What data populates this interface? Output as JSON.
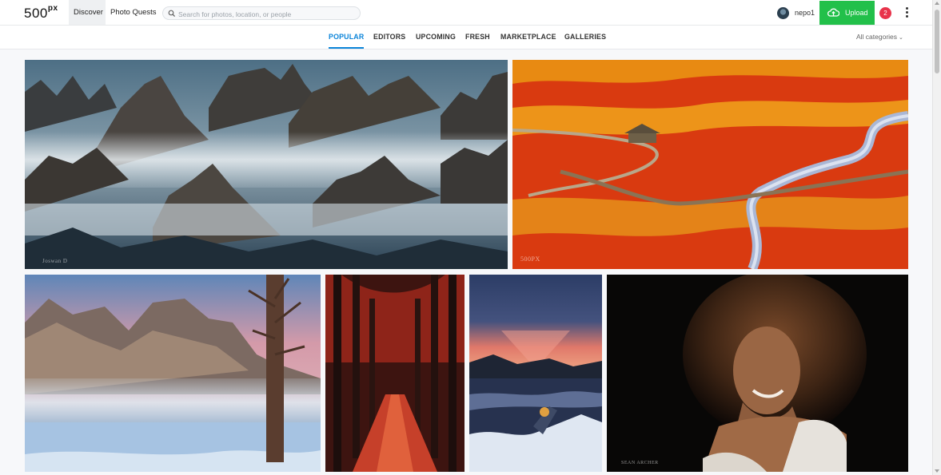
{
  "header": {
    "logo": "500",
    "logo_sup": "px",
    "nav": {
      "discover": "Discover",
      "photo_quests": "Photo Quests"
    },
    "search_placeholder": "Search for photos, location, or people",
    "username": "nepo1",
    "upload_label": "Upload",
    "notification_count": "2"
  },
  "tabs": [
    {
      "label": "POPULAR",
      "active": true
    },
    {
      "label": "EDITORS",
      "active": false
    },
    {
      "label": "UPCOMING",
      "active": false
    },
    {
      "label": "FRESH",
      "active": false
    },
    {
      "label": "MARKETPLACE",
      "active": false
    },
    {
      "label": "GALLERIES",
      "active": false
    }
  ],
  "category_filter": "All categories",
  "photos": [
    {
      "subject": "misty rock pinnacles",
      "watermark": "Joswan D"
    },
    {
      "subject": "red marsh with boardwalk",
      "watermark": "500PX"
    },
    {
      "subject": "snowy mountains and dead tree",
      "watermark": ""
    },
    {
      "subject": "red forest path",
      "watermark": ""
    },
    {
      "subject": "kayaker at sunrise lake",
      "watermark": ""
    },
    {
      "subject": "portrait of smiling woman",
      "watermark": "SEAN ARCHER"
    }
  ],
  "colors": {
    "accent": "#0b84d9",
    "upload": "#22c04a",
    "badge": "#e8334a"
  }
}
